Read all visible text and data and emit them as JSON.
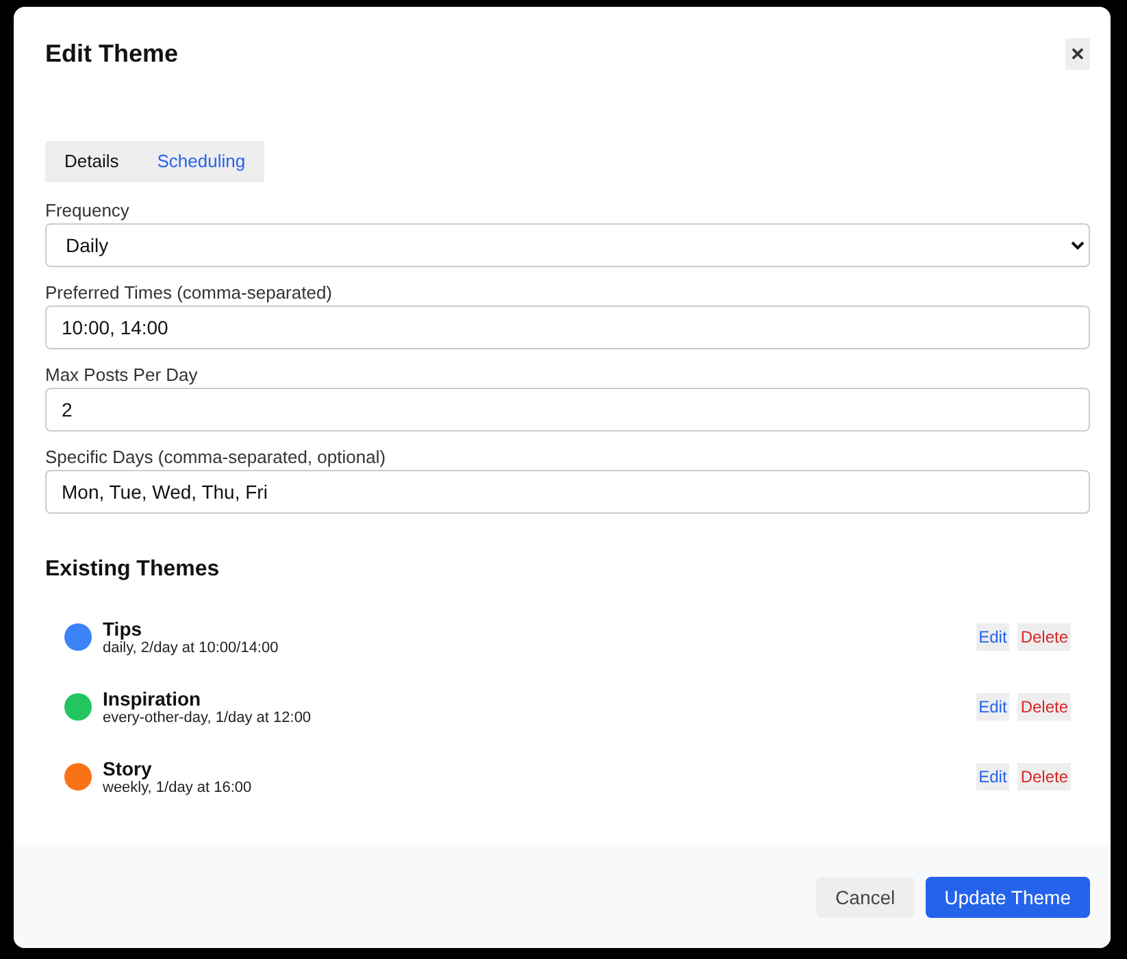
{
  "dialog": {
    "title": "Edit Theme",
    "close": "✕"
  },
  "tabs": [
    {
      "label": "Details",
      "selected": false
    },
    {
      "label": "Scheduling",
      "selected": true
    }
  ],
  "fields": [
    {
      "kind": "select",
      "label": "Frequency",
      "value": "Daily"
    },
    {
      "kind": "input",
      "label": "Preferred Times (comma-separated)",
      "value": "10:00, 14:00"
    },
    {
      "kind": "input",
      "label": "Max Posts Per Day",
      "value": "2"
    },
    {
      "kind": "input",
      "label": "Specific Days (comma-separated, optional)",
      "value": "Mon, Tue, Wed, Thu, Fri"
    }
  ],
  "existing_themes": {
    "heading": "Existing Themes",
    "items": [
      {
        "name": "Tips",
        "schedule": "daily, 2/day at 10:00/14:00",
        "color": "#3b82f6",
        "edit": "Edit",
        "delete": "Delete"
      },
      {
        "name": "Inspiration",
        "schedule": "every-other-day, 1/day at 12:00",
        "color": "#22c55e",
        "edit": "Edit",
        "delete": "Delete"
      },
      {
        "name": "Story",
        "schedule": "weekly, 1/day at 16:00",
        "color": "#f97316",
        "edit": "Edit",
        "delete": "Delete"
      }
    ]
  },
  "footer": {
    "buttons": [
      {
        "kind": "secondary",
        "label": "Cancel"
      },
      {
        "kind": "primary",
        "label": "Update Theme"
      }
    ]
  }
}
